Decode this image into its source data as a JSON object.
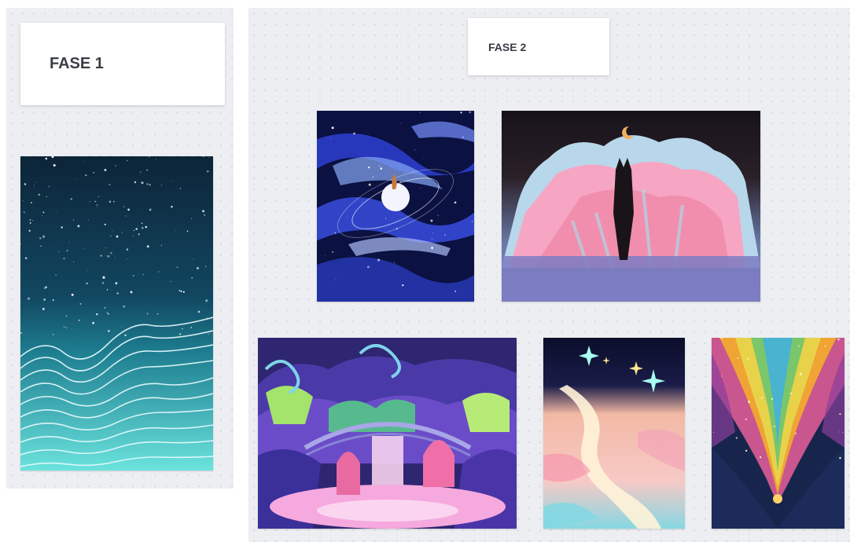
{
  "boards": {
    "phase_1": {
      "label": "FASE 1"
    },
    "phase_2": {
      "label": "FASE 2"
    }
  },
  "artworks": [
    {
      "name": "starry-ocean-waves",
      "palette": [
        "#0b2a44",
        "#1f6f86",
        "#5fe0dc"
      ]
    },
    {
      "name": "cosmic-galaxy-moon",
      "palette": [
        "#0a0f3a",
        "#2d3fbf",
        "#aac4ff"
      ]
    },
    {
      "name": "shadow-figure-clouds",
      "palette": [
        "#1a1520",
        "#f49ab7",
        "#7fd7e6"
      ]
    },
    {
      "name": "fantasy-bridge-waterfall",
      "palette": [
        "#3a2b8a",
        "#8f5bd8",
        "#f4a7d6"
      ]
    },
    {
      "name": "sparkling-river-night",
      "palette": [
        "#0c1030",
        "#f6b6a2",
        "#6fd6e0"
      ]
    },
    {
      "name": "colorful-flames-valley",
      "palette": [
        "#16234a",
        "#f0a234",
        "#c94f8f"
      ]
    }
  ]
}
